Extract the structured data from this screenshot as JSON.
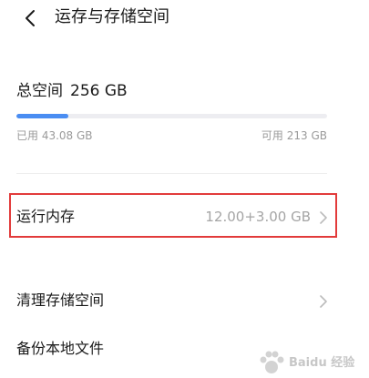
{
  "header": {
    "back_icon": "back-arrow-icon",
    "title": "运存与存储空间"
  },
  "storage": {
    "total_label": "总空间",
    "total_value": "256 GB",
    "used_text": "已用 43.08 GB",
    "free_text": "可用 213 GB",
    "used_fraction": 0.168,
    "bar_color": "#4a8df2",
    "track_color": "#ededf1"
  },
  "rows": {
    "memory": {
      "label": "运行内存",
      "value": "12.00+3.00 GB"
    },
    "cleanup": {
      "label": "清理存储空间"
    },
    "backup": {
      "label": "备份本地文件"
    }
  },
  "highlight": {
    "color": "#e23b3b"
  },
  "watermark": {
    "text": "Baidu 经验"
  }
}
